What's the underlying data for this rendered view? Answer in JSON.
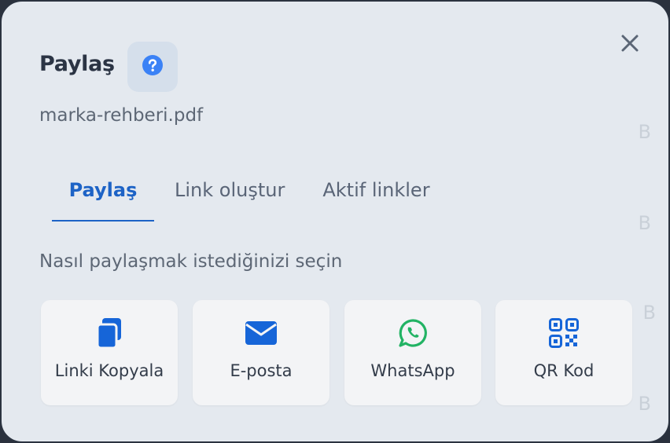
{
  "dialog": {
    "title": "Paylaş",
    "help_icon": "question-circle-icon",
    "close_icon": "close-icon",
    "filename": "marka-rehberi.pdf"
  },
  "tabs": [
    {
      "label": "Paylaş",
      "active": true
    },
    {
      "label": "Link oluştur",
      "active": false
    },
    {
      "label": "Aktif linkler",
      "active": false
    }
  ],
  "share": {
    "prompt": "Nasıl paylaşmak istediğinizi seçin",
    "options": [
      {
        "label": "Linki Kopyala",
        "icon": "copy-icon",
        "color": "#1665d8"
      },
      {
        "label": "E-posta",
        "icon": "envelope-icon",
        "color": "#1665d8"
      },
      {
        "label": "WhatsApp",
        "icon": "whatsapp-icon",
        "color": "#22b364"
      },
      {
        "label": "QR Kod",
        "icon": "qr-code-icon",
        "color": "#1665d8"
      }
    ]
  },
  "background_hints": [
    "B",
    "B",
    "B",
    "B"
  ],
  "colors": {
    "accent": "#1d63c6",
    "dialog_bg": "#e4e9ef",
    "card_bg": "#f3f4f6"
  }
}
